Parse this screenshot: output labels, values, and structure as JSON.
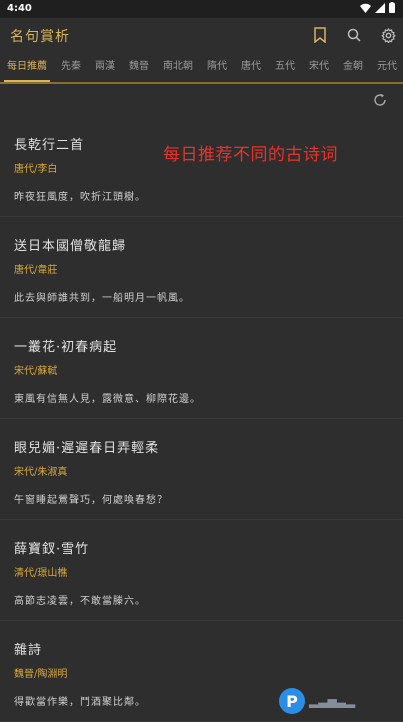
{
  "status": {
    "time": "4:40"
  },
  "app": {
    "title": "名句賞析"
  },
  "tabs": [
    "每日推薦",
    "先秦",
    "兩漢",
    "魏晉",
    "南北朝",
    "隋代",
    "唐代",
    "五代",
    "宋代",
    "金朝",
    "元代"
  ],
  "active_tab_index": 0,
  "overlay_text": "每日推荐不同的古诗词",
  "poems": [
    {
      "title": "長乾行二首",
      "author": "唐代/李白",
      "line": "昨夜狂風度，吹折江頭樹。"
    },
    {
      "title": "送日本國僧敬龍歸",
      "author": "唐代/韋莊",
      "line": "此去與師誰共到，一船明月一帆風。"
    },
    {
      "title": "一叢花·初春病起",
      "author": "宋代/蘇軾",
      "line": "東風有信無人見，露微意、柳際花邊。"
    },
    {
      "title": "眼兒媚·遲遲春日弄輕柔",
      "author": "宋代/朱淑真",
      "line": "午窗睡起鶯聲巧，何處喚春愁？"
    },
    {
      "title": "薛寶釵·雪竹",
      "author": "清代/璟山樵",
      "line": "高節志凌雲，不敢當滕六。"
    },
    {
      "title": "雜詩",
      "author": "魏晉/陶淵明",
      "line": "得歡當作樂，鬥酒聚比鄰。"
    }
  ],
  "icons": {
    "bookmark": "bookmark-icon",
    "search": "search-icon",
    "settings": "gear-icon",
    "refresh": "refresh-icon"
  },
  "colors": {
    "accent": "#d8b45a",
    "author": "#d8a83a",
    "overlay": "#e8332a",
    "background": "#2e2e2e"
  }
}
